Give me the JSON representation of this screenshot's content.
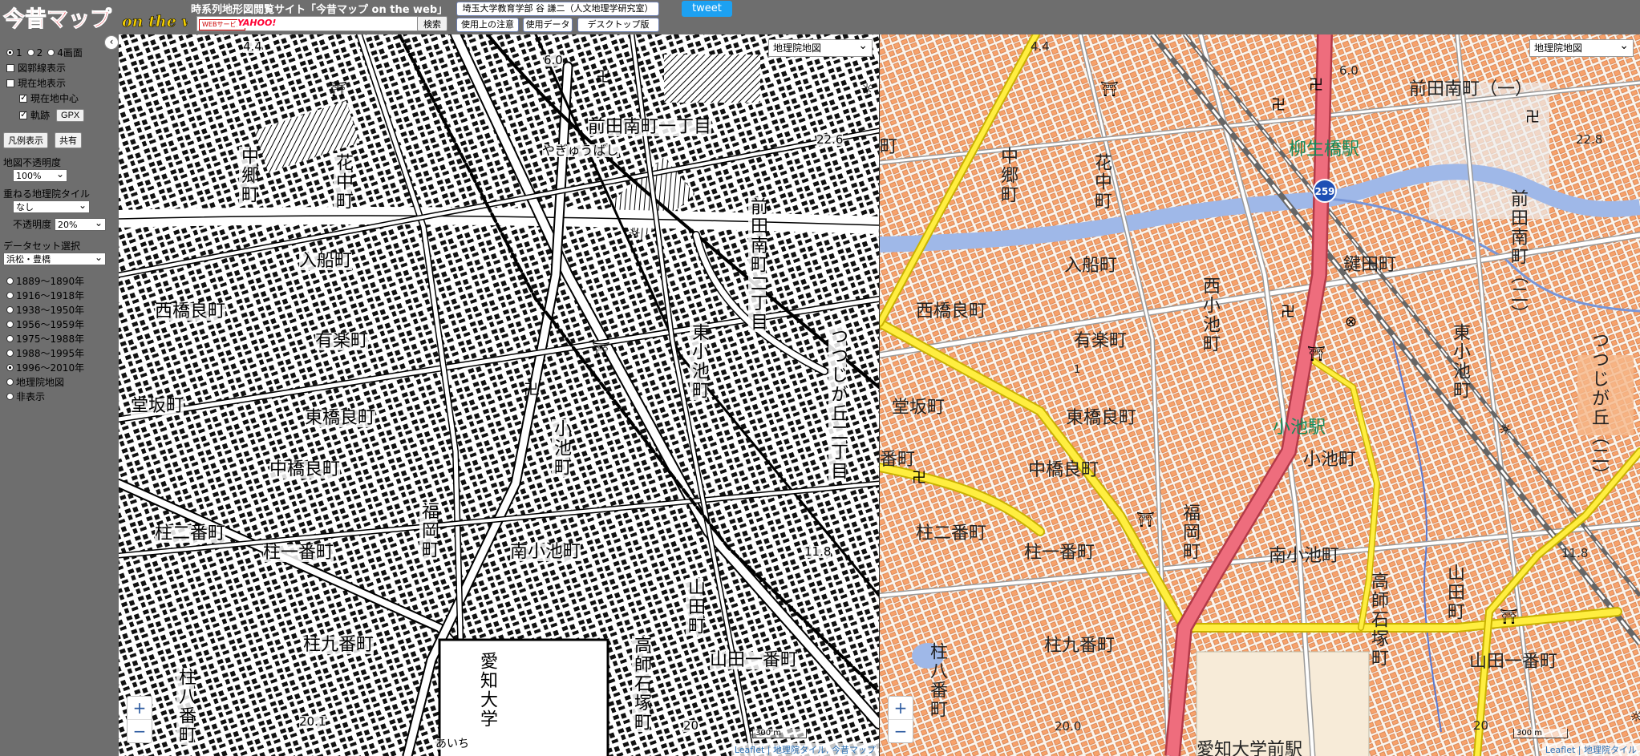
{
  "header": {
    "logo_text": "今昔マップ on the web",
    "site_title": "時系列地形図閲覧サイト「今昔マップ on the web」",
    "badge_web": "WEBサービス",
    "badge_yahoo": "YAHOO!",
    "search_placeholder": "",
    "search_button": "検索",
    "affiliation": "埼玉大学教育学部 谷 謙二（人文地理学研究室）",
    "notes_button": "使用上の注意",
    "data_button": "使用データ",
    "desktop_button": "デスクトップ版",
    "tweet_button": "tweet"
  },
  "panel": {
    "screen_options": [
      "1",
      "2",
      "4画面"
    ],
    "selected_screen": "2",
    "grid_label": "図郭線表示",
    "current_map_label": "現在地表示",
    "center_label": "現在地中心",
    "track_label": "軌跡",
    "gpx_button": "GPX",
    "legend_button": "凡例表示",
    "share_button": "共有",
    "opacity_label": "地図不透明度",
    "opacity_value": "100%",
    "overlay_label": "重ねる地理院タイル",
    "overlay_value": "なし",
    "overlay_opacity_label": "不透明度",
    "overlay_opacity_value": "20%",
    "dataset_label": "データセット選択",
    "dataset_value": "浜松・豊橋",
    "periods": [
      "1889～1890年",
      "1916～1918年",
      "1938～1950年",
      "1956～1959年",
      "1975～1988年",
      "1988～1995年",
      "1996～2010年",
      "地理院地図",
      "非表示"
    ],
    "selected_period": "1996～2010年"
  },
  "map_left": {
    "layer_select": "地理院地図",
    "labels": {
      "maeda_minami_1": "前田南町一丁目",
      "yagyu_bashi": "やぎゅうばし",
      "nakago": "中郷町",
      "hananaka": "花中町",
      "iribune": "入船町",
      "nishi_hashira": "西橋良町",
      "yuraku": "有楽町",
      "doban": "堂坂町",
      "higashi_hashira": "東橋良町",
      "naka_hashira": "中橋良町",
      "hashira_2": "柱二番町",
      "hashira_1": "柱一番町",
      "hashira_9": "柱九番町",
      "hashira_8": "柱八番町",
      "fukuoka": "福岡町",
      "minami_koike": "南小池町",
      "koike": "小池町",
      "higashi_koike": "東小池町",
      "maeda_minami_2": "前田南町二丁目",
      "tsutsujigaoka": "つつじが丘二丁目",
      "takashi_ishizuka": "高師石塚町",
      "yamada": "山田町",
      "yamada_1": "山田一番町",
      "aichi_univ": "愛知大学",
      "elev_44": "4.4",
      "elev_60": "6.0",
      "elev_226": "22.6",
      "elev_118": "11.8",
      "elev_201": "20.1",
      "aikyo": "あいち",
      "elev_20": "20"
    },
    "scale": "300 m",
    "attribution": "Leaflet | 地理院タイル, 今昔マップ"
  },
  "map_right": {
    "layer_select": "地理院地図",
    "labels": {
      "maeda_minami_1": "前田南町（一）",
      "yagyubashi_station": "柳生橋駅",
      "route_259": "259",
      "nakago": "中郷町",
      "hananaka": "花中町",
      "iribune": "入船町",
      "kagita": "鍵田町",
      "nishi_koike": "西小池町",
      "nishi_hashira": "西橋良町",
      "yuraku": "有楽町",
      "doban": "堂坂町",
      "higashi_hashira": "東橋良町",
      "koike_station": "小池駅",
      "koike": "小池町",
      "higashi_koike": "東小池町",
      "naka_hashira": "中橋良町",
      "hashira_2": "柱二番町",
      "hashira_1": "柱一番町",
      "fukuoka": "福岡町",
      "minami_koike": "南小池町",
      "takashi_ishizuka": "高師石塚町",
      "yamada": "山田町",
      "yamada_1": "山田一番町",
      "hashira_9": "柱九番町",
      "hashira_8": "柱八番町",
      "maeda_minami_2": "前田南町（二）",
      "tsutsujigaoka": "つつじが丘（二）",
      "aichi_univ_mae": "愛知大学前駅",
      "ban": "番町",
      "machi": "町",
      "elev_44": "4.4",
      "elev_60": "6.0",
      "elev_228": "22.8",
      "elev_118": "11.8",
      "elev_200": "20.0",
      "elev_20": "20",
      "elev_1": "1"
    },
    "scale": "300 m",
    "attribution": "Leaflet | 地理院タイル"
  }
}
